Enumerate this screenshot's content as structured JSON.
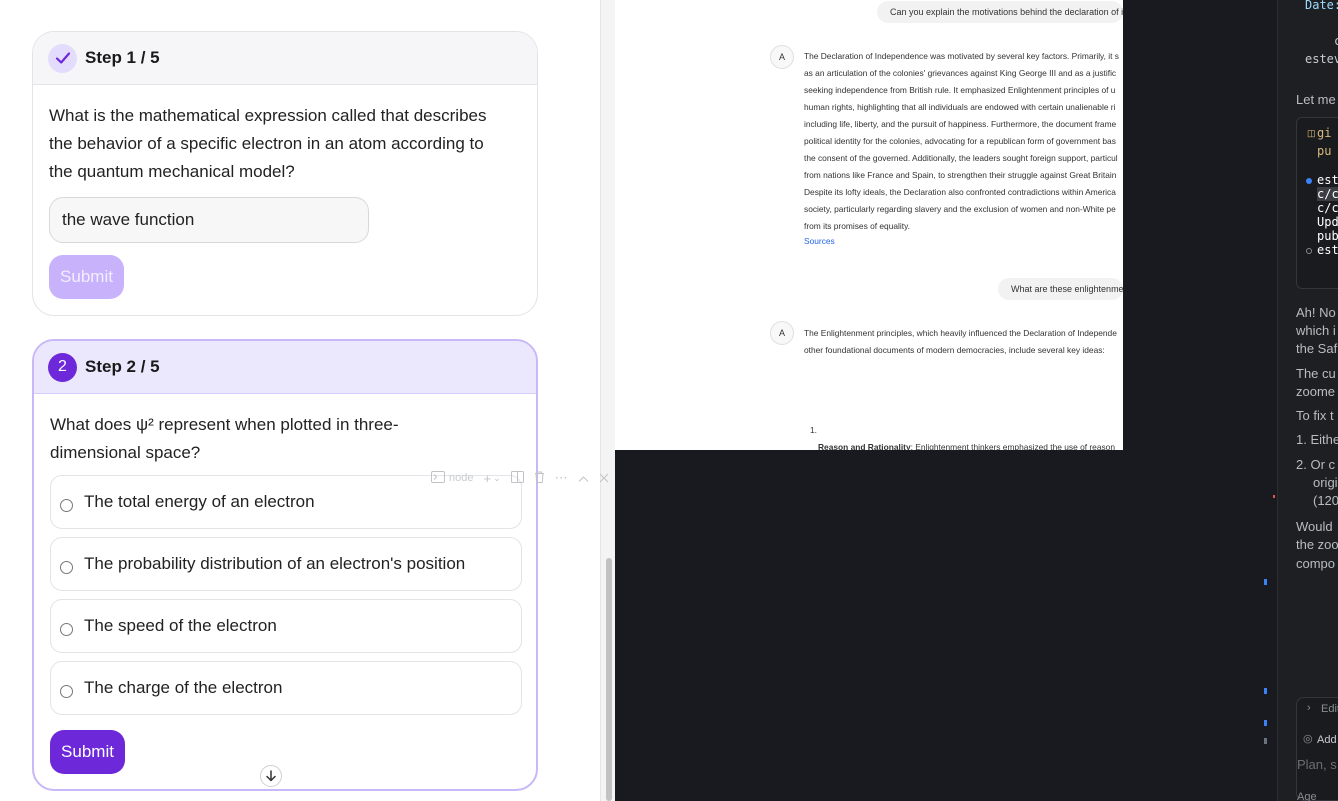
{
  "quiz": {
    "step1": {
      "title": "Step 1 / 5",
      "question": "What is the mathematical expression called that describes the behavior of a specific electron in an atom according to the quantum mechanical model?",
      "answer_value": "the wave function",
      "submit_label": "Submit"
    },
    "step2": {
      "number": "2",
      "title": "Step 2 / 5",
      "question": "What does ψ² represent when plotted in three-dimensional space?",
      "options": [
        "The total energy of an electron",
        "The probability distribution of an electron's position",
        "The speed of the electron",
        "The charge of the electron"
      ],
      "submit_label": "Submit"
    },
    "scroll_down_icon": "arrow-down-icon"
  },
  "chat": {
    "question1": "Can you explain the motivations behind the declaration of inde",
    "avatar": "A",
    "answer1_lines": [
      "The Declaration of Independence was motivated by several key factors. Primarily, it s",
      "as an articulation of the colonies' grievances against King George III and as a justific",
      "seeking independence from British rule. It emphasized Enlightenment principles of u",
      "human rights, highlighting that all individuals are endowed with certain unalienable ri",
      "including life, liberty, and the pursuit of happiness. Furthermore, the document frame",
      "political identity for the colonies, advocating for a republican form of government bas",
      "the consent of the governed. Additionally, the leaders sought foreign support, particul",
      "from nations like France and Spain, to strengthen their struggle against Great Britain",
      "Despite its lofty ideals, the Declaration also confronted contradictions within America",
      "society, particularly regarding slavery and the exclusion of women and non-White pe",
      "from its promises of equality."
    ],
    "sources_label": "Sources",
    "question2": "What are these enlightenment",
    "answer2_lines": [
      "The Enlightenment principles, which heavily influenced the Declaration of Independe",
      "other foundational documents of modern democracies, include several key ideas:"
    ],
    "list_number": "1.",
    "list_item_bold": "Reason and Rationality",
    "list_item_rest": ": Enlightenment thinkers emphasized the use of reason"
  },
  "terminal": {
    "name": "node",
    "icons": [
      "terminal-icon",
      "plus-icon",
      "chevron-down-icon",
      "split-icon",
      "trash-icon",
      "more-icon",
      "chevron-up-icon",
      "close-icon"
    ]
  },
  "assistant": {
    "top_lines": [
      "Date:",
      "c",
      "estev"
    ],
    "let_me": "Let me",
    "code_lines": [
      "gi",
      "pu"
    ],
    "commit_lines": [
      "est",
      "c/c",
      "c/c",
      "Upd",
      "pub",
      "est"
    ],
    "para1": [
      "Ah! No",
      "which i",
      "the Saf"
    ],
    "para2": [
      "The cu",
      "zoome"
    ],
    "para3": "To fix t",
    "list_items": [
      "1. Eithe",
      "2. Or c",
      "origi",
      "(120"
    ],
    "para4": [
      "Would",
      "the zoo",
      "compo"
    ],
    "edit_label": "Edit",
    "add_label": "Add",
    "plan_placeholder": "Plan, s",
    "agent_label": "Age"
  }
}
